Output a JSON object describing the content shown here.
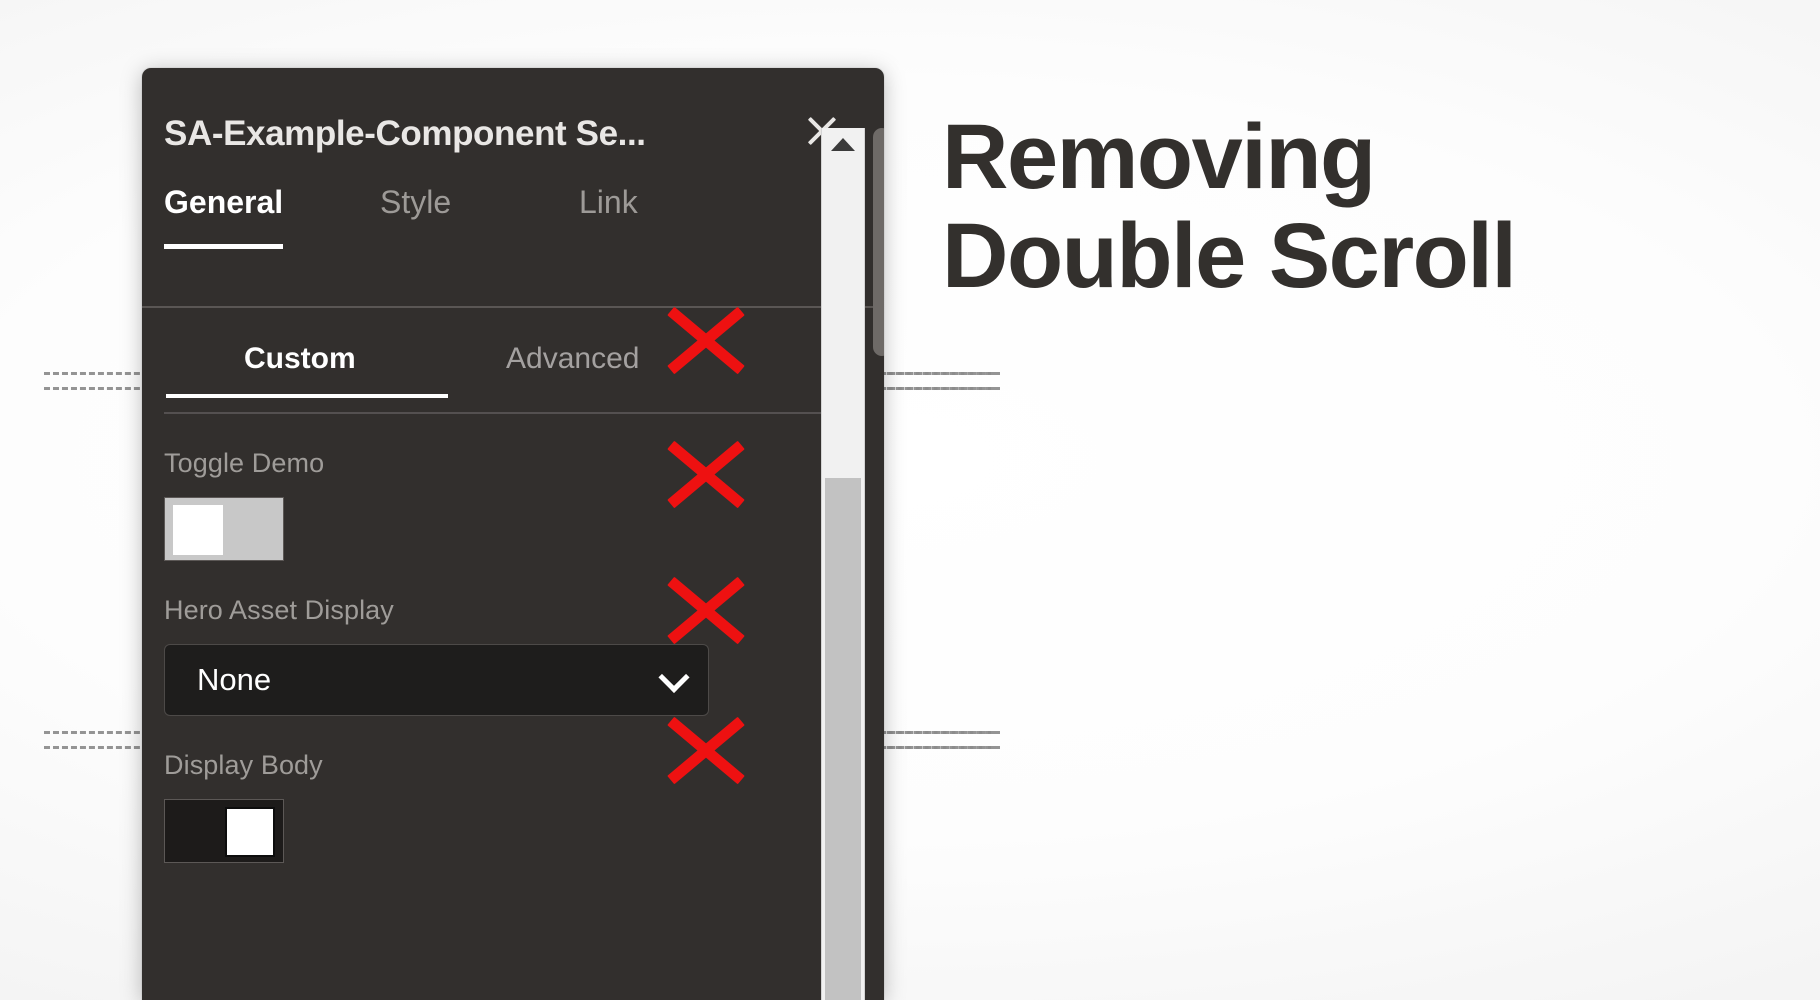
{
  "page": {
    "background_color": "#ffffff",
    "headline": {
      "line1": "Removing",
      "line2": "Double Scroll"
    }
  },
  "guides": {
    "top_label": "upper alignment guide",
    "bottom_label": "lower alignment guide"
  },
  "dialog": {
    "title": "SA-Example-Component Se...",
    "close_label": "Close",
    "background_color": "#322f2d",
    "tabs": [
      {
        "label": "General",
        "active": true
      },
      {
        "label": "Style",
        "active": false
      },
      {
        "label": "Link",
        "active": false
      }
    ],
    "sub_tabs": [
      {
        "label": "Custom",
        "active": true
      },
      {
        "label": "Advanced",
        "active": false
      }
    ],
    "fields": [
      {
        "label": "Toggle Demo",
        "type": "toggle",
        "state": "off",
        "state_label": "Off"
      },
      {
        "label": "Hero Asset Display",
        "type": "select",
        "value": "None",
        "options": [
          "None"
        ]
      },
      {
        "label": "Display Body",
        "type": "toggle",
        "state": "on",
        "state_label": "On"
      }
    ],
    "scrollbars": {
      "inner": {
        "name": "inner-panel-scrollbar",
        "style": "classic-light",
        "track_color": "#f1f1f1",
        "thumb_color": "#c2c2c2"
      },
      "outer": {
        "name": "outer-dialog-scrollbar",
        "style": "dark-rounded",
        "thumb_color": "#6e6a67"
      }
    },
    "annotations": {
      "mark": "red-x",
      "mark_color": "#ee1111",
      "count": 4,
      "meaning": "scrollbars to be removed"
    }
  }
}
